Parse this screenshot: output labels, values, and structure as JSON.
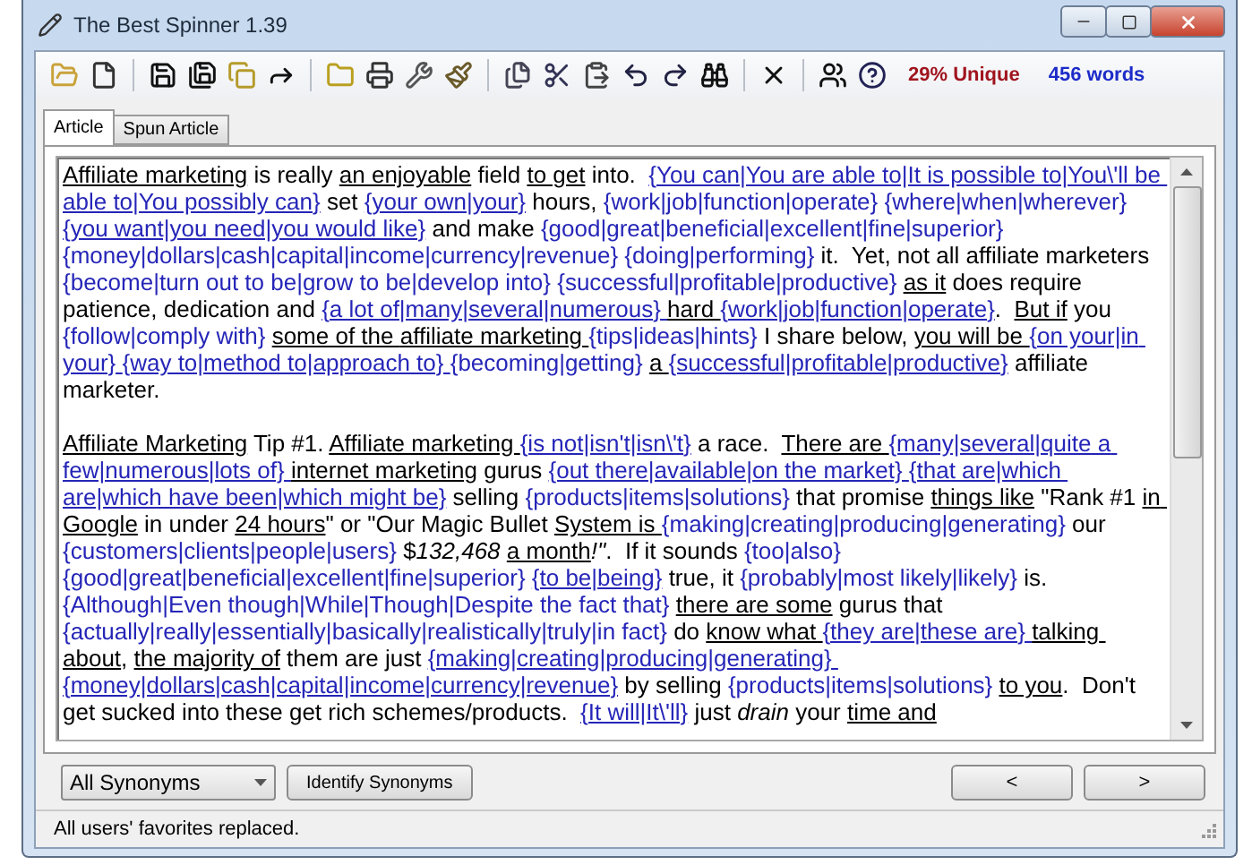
{
  "window": {
    "title": "The Best Spinner 1.39"
  },
  "toolbar": {
    "unique": "29% Unique",
    "words": "456 words"
  },
  "tabs": [
    {
      "label": "Article",
      "selected": true
    },
    {
      "label": "Spun Article",
      "selected": false
    }
  ],
  "article": {
    "paragraphs": [
      [
        {
          "kind": "phrase",
          "text": "Affiliate marketing"
        },
        {
          "kind": "plain",
          "text": " is really "
        },
        {
          "kind": "phrase",
          "text": "an enjoyable"
        },
        {
          "kind": "plain",
          "text": " field "
        },
        {
          "kind": "phrase",
          "text": "to get"
        },
        {
          "kind": "plain",
          "text": " into.  "
        },
        {
          "kind": "spin-phrase",
          "text": "{You can|You are able to|It is possible to|You\\'ll be able to|You possibly can}"
        },
        {
          "kind": "plain",
          "text": " set "
        },
        {
          "kind": "spin-phrase",
          "text": "{your own|your}"
        },
        {
          "kind": "plain",
          "text": " hours, "
        },
        {
          "kind": "spin",
          "text": "{work|job|function|operate} "
        },
        {
          "kind": "spin",
          "text": "{where|when|wherever} "
        },
        {
          "kind": "spin-phrase",
          "text": "{you want|you need|you would like}"
        },
        {
          "kind": "plain",
          "text": " and make "
        },
        {
          "kind": "spin",
          "text": "{good|great|beneficial|excellent|fine|superior} "
        },
        {
          "kind": "spin",
          "text": "{money|dollars|cash|capital|income|currency|revenue} "
        },
        {
          "kind": "spin",
          "text": "{doing|performing}"
        },
        {
          "kind": "plain",
          "text": " it.  Yet, not all affiliate marketers "
        },
        {
          "kind": "spin",
          "text": "{become|turn out to be|grow to be|develop into} "
        },
        {
          "kind": "spin",
          "text": "{successful|profitable|productive} "
        },
        {
          "kind": "phrase",
          "text": "as it"
        },
        {
          "kind": "plain",
          "text": " does require patience, dedication and "
        },
        {
          "kind": "spin-phrase",
          "text": "{a lot of|many|several|numerous} "
        },
        {
          "kind": "phrase",
          "text": "hard "
        },
        {
          "kind": "spin-phrase",
          "text": "{work|job|function|operate}"
        },
        {
          "kind": "plain",
          "text": ".  "
        },
        {
          "kind": "phrase",
          "text": "But if"
        },
        {
          "kind": "plain",
          "text": " you "
        },
        {
          "kind": "spin",
          "text": "{follow|comply with} "
        },
        {
          "kind": "phrase",
          "text": "some of the "
        },
        {
          "kind": "phrase",
          "text": "affiliate marketing "
        },
        {
          "kind": "spin",
          "text": "{tips|ideas|hints}"
        },
        {
          "kind": "plain",
          "text": " I share below, "
        },
        {
          "kind": "phrase",
          "text": "you will be "
        },
        {
          "kind": "spin-phrase",
          "text": "{on your|in your} "
        },
        {
          "kind": "spin-phrase",
          "text": "{way to|method to|approach to} "
        },
        {
          "kind": "spin",
          "text": "{becoming|getting} "
        },
        {
          "kind": "phrase",
          "text": "a "
        },
        {
          "kind": "spin-phrase",
          "text": "{successful|profitable|productive}"
        },
        {
          "kind": "plain",
          "text": " affiliate marketer."
        }
      ],
      [
        {
          "kind": "phrase",
          "text": "Affiliate Marketing"
        },
        {
          "kind": "plain",
          "text": " Tip #1. "
        },
        {
          "kind": "phrase",
          "text": "Affiliate marketing "
        },
        {
          "kind": "spin-phrase",
          "text": "{is not|isn't|isn\\'t}"
        },
        {
          "kind": "plain",
          "text": " a race.  "
        },
        {
          "kind": "phrase",
          "text": "There are "
        },
        {
          "kind": "spin-phrase",
          "text": "{many|several|quite a few|numerous|lots of} "
        },
        {
          "kind": "phrase",
          "text": "internet marketing"
        },
        {
          "kind": "plain",
          "text": " gurus "
        },
        {
          "kind": "spin-phrase",
          "text": "{out there|available|on the market} "
        },
        {
          "kind": "spin-phrase",
          "text": "{that are|which are|which have been|which might be}"
        },
        {
          "kind": "plain",
          "text": " selling "
        },
        {
          "kind": "spin",
          "text": "{products|items|solutions}"
        },
        {
          "kind": "plain",
          "text": " that promise "
        },
        {
          "kind": "phrase",
          "text": "things like"
        },
        {
          "kind": "plain",
          "text": " \"Rank #1 "
        },
        {
          "kind": "phrase",
          "text": "in Google"
        },
        {
          "kind": "plain",
          "text": " in under "
        },
        {
          "kind": "phrase",
          "text": "24 hours"
        },
        {
          "kind": "plain",
          "text": "\" or \"Our Magic Bullet "
        },
        {
          "kind": "phrase",
          "text": "System is "
        },
        {
          "kind": "spin",
          "text": "{making|creating|producing|generating}"
        },
        {
          "kind": "plain",
          "text": " our "
        },
        {
          "kind": "spin",
          "text": "{customers|clients|people|users}"
        },
        {
          "kind": "plain",
          "text": " $"
        },
        {
          "kind": "italic",
          "text": "132,468 "
        },
        {
          "kind": "phrase",
          "text": "a month"
        },
        {
          "kind": "italic",
          "text": "!\""
        },
        {
          "kind": "plain",
          "text": ".  If it sounds "
        },
        {
          "kind": "spin",
          "text": "{too|also} "
        },
        {
          "kind": "spin",
          "text": "{good|great|beneficial|excellent|fine|superior} "
        },
        {
          "kind": "spin-phrase",
          "text": "{to be|being}"
        },
        {
          "kind": "plain",
          "text": " true, it "
        },
        {
          "kind": "spin",
          "text": "{probably|most likely|likely}"
        },
        {
          "kind": "plain",
          "text": " is. "
        },
        {
          "kind": "spin",
          "text": "{Although|Even though|While|Though|Despite the fact that} "
        },
        {
          "kind": "phrase",
          "text": "there are some"
        },
        {
          "kind": "plain",
          "text": " gurus that "
        },
        {
          "kind": "spin",
          "text": "{actually|really|essentially|basically|realistically|truly|in fact}"
        },
        {
          "kind": "plain",
          "text": " do "
        },
        {
          "kind": "phrase",
          "text": "know what "
        },
        {
          "kind": "spin-phrase",
          "text": "{they are|these are} "
        },
        {
          "kind": "phrase",
          "text": "talking about"
        },
        {
          "kind": "plain",
          "text": ", "
        },
        {
          "kind": "phrase",
          "text": "the majority of"
        },
        {
          "kind": "plain",
          "text": " them are just "
        },
        {
          "kind": "spin-phrase",
          "text": "{making|creating|producing|generating} "
        },
        {
          "kind": "spin-phrase",
          "text": "{money|dollars|cash|capital|income|currency|revenue}"
        },
        {
          "kind": "plain",
          "text": " by selling "
        },
        {
          "kind": "spin",
          "text": "{products|items|solutions} "
        },
        {
          "kind": "phrase",
          "text": "to you"
        },
        {
          "kind": "plain",
          "text": ".  Don't get sucked into these get rich schemes/products.  "
        },
        {
          "kind": "spin-phrase",
          "text": "{It will|It\\'ll}"
        },
        {
          "kind": "plain",
          "text": " just "
        },
        {
          "kind": "italic",
          "text": "drain"
        },
        {
          "kind": "plain",
          "text": " your "
        },
        {
          "kind": "phrase",
          "text": "time and"
        }
      ]
    ]
  },
  "footer": {
    "filter": "All Synonyms",
    "identify_button": "Identify Synonyms",
    "prev_button": "<",
    "next_button": ">"
  },
  "status_bar": "All users' favorites replaced."
}
